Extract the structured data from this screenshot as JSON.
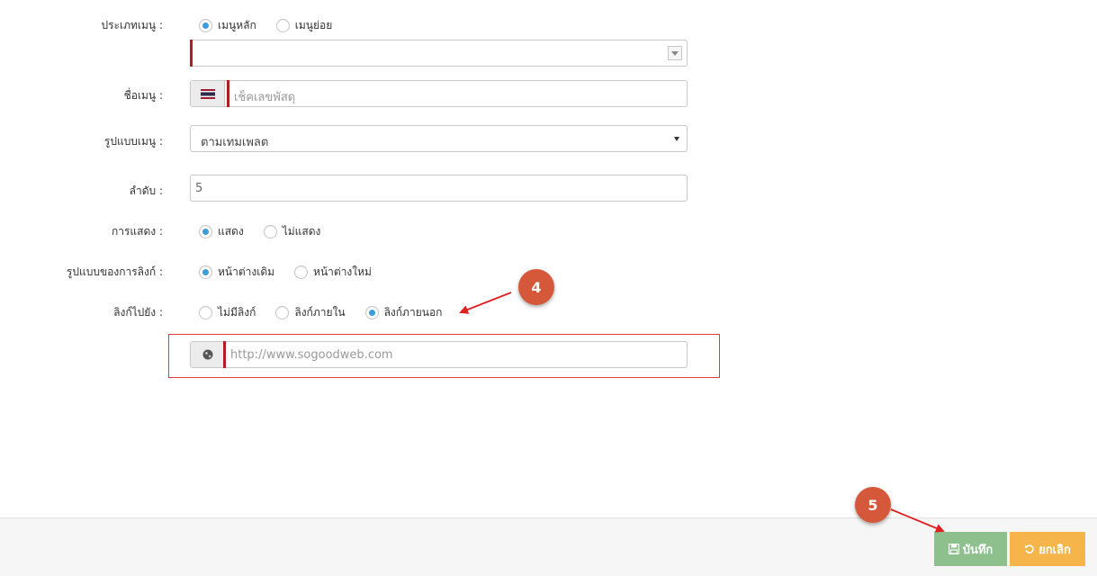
{
  "form": {
    "menu_type": {
      "label": "ประเภทเมนู :",
      "options": [
        {
          "label": "เมนูหลัก",
          "checked": true
        },
        {
          "label": "เมนูย่อย",
          "checked": false
        }
      ],
      "parent_select_value": ""
    },
    "menu_name": {
      "label": "ชื่อเมนู :",
      "placeholder": "เช็คเลขพัสดุ",
      "flag_icon": "thai-flag-icon"
    },
    "menu_format": {
      "label": "รูปแบบเมนู :",
      "selected": "ตามเทมเพลต"
    },
    "order": {
      "label": "ลำดับ :",
      "value": "5"
    },
    "display": {
      "label": "การแสดง :",
      "options": [
        {
          "label": "แสดง",
          "checked": true
        },
        {
          "label": "ไม่แสดง",
          "checked": false
        }
      ]
    },
    "link_format": {
      "label": "รูปแบบของการลิงก์ :",
      "options": [
        {
          "label": "หน้าต่างเดิม",
          "checked": true
        },
        {
          "label": "หน้าต่างใหม่",
          "checked": false
        }
      ]
    },
    "link_to": {
      "label": "ลิงก์ไปยัง :",
      "options": [
        {
          "label": "ไม่มีลิงก์",
          "checked": false
        },
        {
          "label": "ลิงก์ภายใน",
          "checked": false
        },
        {
          "label": "ลิงก์ภายนอก",
          "checked": true
        }
      ]
    },
    "url": {
      "placeholder": "http://www.sogoodweb.com",
      "icon": "globe-icon"
    }
  },
  "footer": {
    "save_label": "บันทึก",
    "cancel_label": "ยกเลิก",
    "save_icon": "floppy-icon",
    "cancel_icon": "undo-icon"
  },
  "annotations": {
    "step4": "4",
    "step5": "5"
  },
  "colors": {
    "radio_checked": "#3c9dd9",
    "required_bar": "#b11f24",
    "save_button": "#8dc08d",
    "cancel_button": "#f6b54b",
    "badge": "#d6583a",
    "annotation_arrow": "#e02020"
  }
}
